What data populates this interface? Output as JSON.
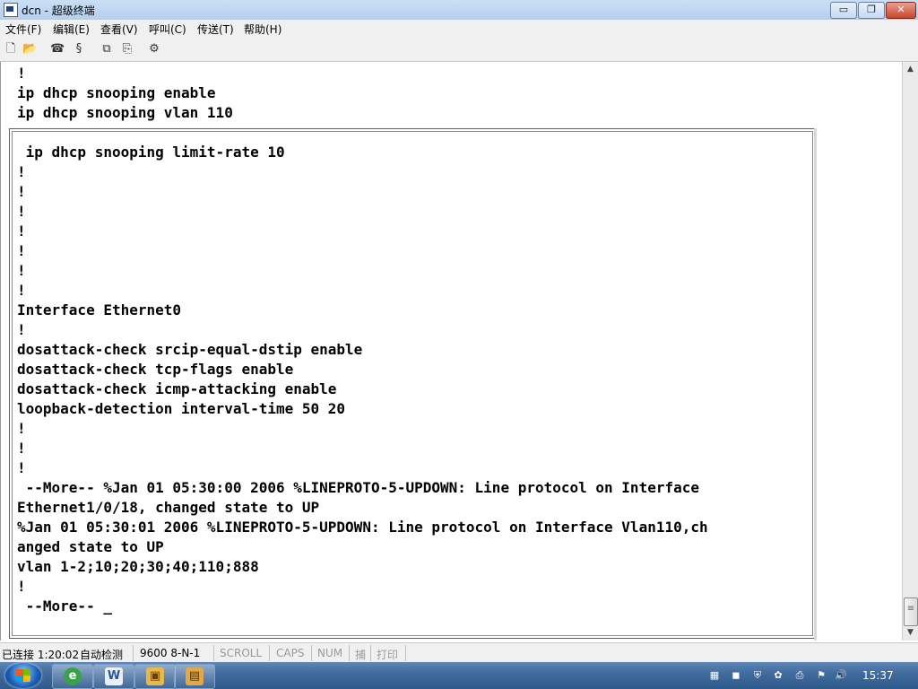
{
  "window": {
    "title": "dcn - 超级终端",
    "buttons": {
      "minimize": "▭",
      "maximize": "❐",
      "close": "✕"
    }
  },
  "menu": [
    "文件(F)",
    "编辑(E)",
    "查看(V)",
    "呼叫(C)",
    "传送(T)",
    "帮助(H)"
  ],
  "toolbar": [
    "new-icon",
    "open-icon",
    "disconnect-icon",
    "dial-icon",
    "send-icon",
    "receive-icon",
    "properties-icon"
  ],
  "terminal": {
    "lines": [
      "!",
      "ip dhcp snooping enable",
      "ip dhcp snooping vlan 110",
      "",
      " ip dhcp snooping limit-rate 10",
      "!",
      "!",
      "!",
      "!",
      "!",
      "!",
      "!",
      "Interface Ethernet0",
      "!",
      "dosattack-check srcip-equal-dstip enable",
      "dosattack-check tcp-flags enable",
      "dosattack-check icmp-attacking enable",
      "loopback-detection interval-time 50 20",
      "!",
      "!",
      "!",
      " --More-- %Jan 01 05:30:00 2006 %LINEPROTO-5-UPDOWN: Line protocol on Interface",
      "Ethernet1/0/18, changed state to UP",
      "%Jan 01 05:30:01 2006 %LINEPROTO-5-UPDOWN: Line protocol on Interface Vlan110,ch",
      "anged state to UP",
      "vlan 1-2;10;20;30;40;110;888",
      "!",
      " --More-- _"
    ]
  },
  "statusbar": {
    "connected": "已连接 1:20:02",
    "detect": "自动检测",
    "baud": "9600 8-N-1",
    "scroll": "SCROLL",
    "caps": "CAPS",
    "num": "NUM",
    "capture": "捕",
    "print": "打印"
  },
  "taskbar": {
    "apps": [
      "ie-icon",
      "word-icon",
      "package-icon",
      "hyperterminal-icon"
    ],
    "tray": [
      "network-icon",
      "security-icon",
      "shield-icon",
      "update-icon",
      "clipboard-icon",
      "flag-icon",
      "volume-icon"
    ],
    "clock": "15:37"
  }
}
